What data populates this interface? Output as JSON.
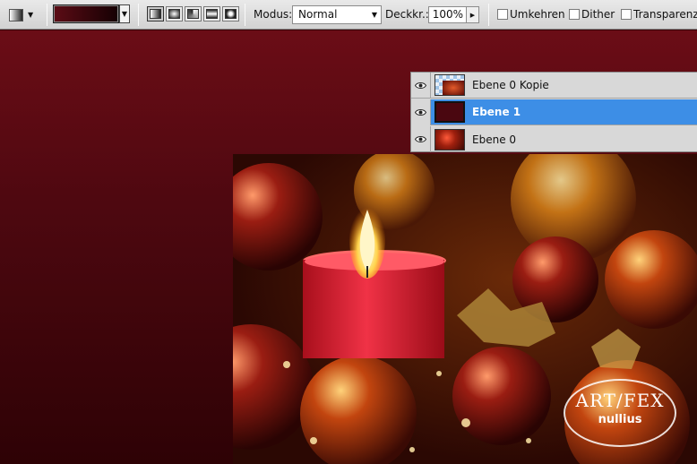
{
  "options_bar": {
    "mode_label": "Modus:",
    "mode_value": "Normal",
    "opacity_label": "Deckkr.:",
    "opacity_value": "100%",
    "reverse_label": "Umkehren",
    "dither_label": "Dither",
    "transparency_label": "Transparenz",
    "gradient_colors": [
      "#5c0c15",
      "#150003"
    ]
  },
  "layers": [
    {
      "name": "Ebene 0 Kopie",
      "selected": false
    },
    {
      "name": "Ebene 1",
      "selected": true
    },
    {
      "name": "Ebene 0",
      "selected": false
    }
  ],
  "watermark": {
    "line1": "ART/FEX",
    "line2": "nullius"
  },
  "colors": {
    "selection": "#3d8ee6",
    "canvas_top": "#6b0d16",
    "canvas_bottom": "#2e0205"
  }
}
